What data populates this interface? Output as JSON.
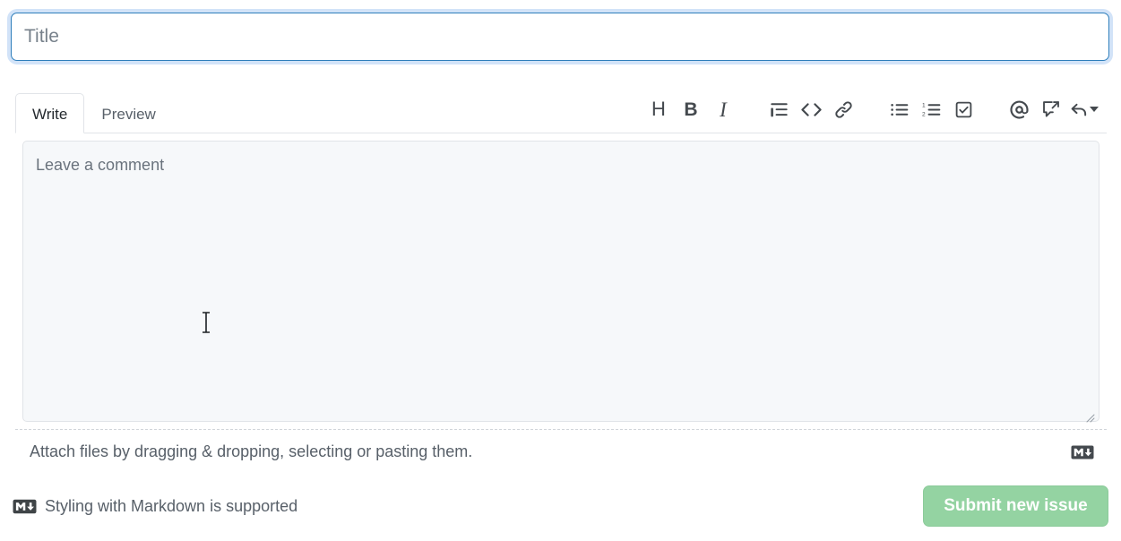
{
  "title_field": {
    "placeholder": "Title",
    "value": "",
    "focused": true,
    "focus_ring_color": "#0366d6"
  },
  "tabs": [
    {
      "label": "Write",
      "active": true
    },
    {
      "label": "Preview",
      "active": false
    }
  ],
  "toolbar": {
    "groups": [
      [
        {
          "name": "heading-icon",
          "glyph": "H",
          "tooltip": "Add heading text"
        },
        {
          "name": "bold-icon",
          "glyph": "B",
          "tooltip": "Add bold text"
        },
        {
          "name": "italic-icon",
          "glyph": "I",
          "tooltip": "Add italic text"
        }
      ],
      [
        {
          "name": "quote-icon",
          "glyph": "",
          "tooltip": "Add a quote"
        },
        {
          "name": "code-icon",
          "glyph": "<>",
          "tooltip": "Add code"
        },
        {
          "name": "link-icon",
          "glyph": "",
          "tooltip": "Add a link"
        }
      ],
      [
        {
          "name": "bulleted-list-icon",
          "glyph": "",
          "tooltip": "Add a bulleted list"
        },
        {
          "name": "numbered-list-icon",
          "glyph": "",
          "tooltip": "Add a numbered list"
        },
        {
          "name": "task-list-icon",
          "glyph": "",
          "tooltip": "Add a task list"
        }
      ],
      [
        {
          "name": "mention-icon",
          "glyph": "@",
          "tooltip": "Directly mention a user or team"
        },
        {
          "name": "cross-reference-icon",
          "glyph": "",
          "tooltip": "Reference an issue, pull request, or discussion"
        },
        {
          "name": "saved-reply-icon",
          "glyph": "",
          "tooltip": "Add saved reply"
        }
      ]
    ]
  },
  "comment": {
    "placeholder": "Leave a comment",
    "value": ""
  },
  "attach": {
    "text": "Attach files by dragging & dropping, selecting or pasting them.",
    "markdown_icon": "markdown-icon"
  },
  "footer": {
    "markdown_note": "Styling with Markdown is supported",
    "markdown_icon": "markdown-icon",
    "submit_label": "Submit new issue",
    "submit_disabled": true,
    "submit_color": "#94d3a2"
  },
  "colors": {
    "border": "#e1e4e8",
    "textarea_bg": "#f6f8fa",
    "muted_text": "#586069",
    "text": "#24292e"
  }
}
